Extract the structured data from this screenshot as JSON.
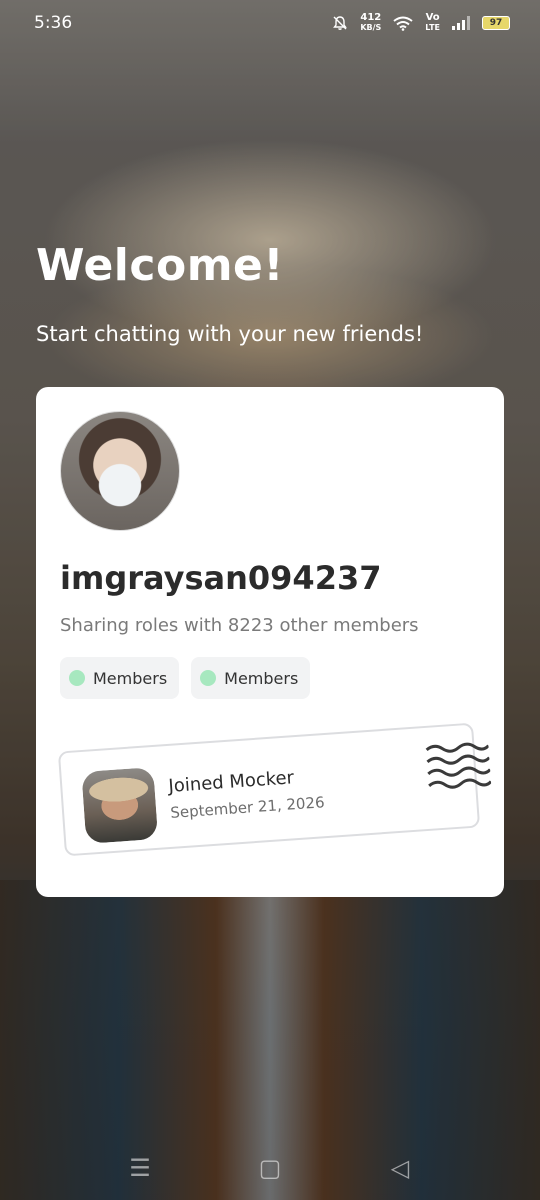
{
  "status_bar": {
    "time": "5:36",
    "net_speed_value": "412",
    "net_speed_unit": "KB/S",
    "network_label_top": "Vo",
    "network_label_bottom": "LTE",
    "battery": "97"
  },
  "welcome": {
    "title": "Welcome!",
    "subtitle": "Start chatting with your new friends!"
  },
  "profile": {
    "username": "imgraysan094237",
    "shared_roles_text": "Sharing roles with 8223 other members",
    "roles": [
      {
        "label": "Members",
        "color": "#a7e8bf"
      },
      {
        "label": "Members",
        "color": "#a7e8bf"
      }
    ],
    "joined": {
      "title": "Joined Mocker",
      "date": "September 21, 2026"
    }
  },
  "nav": {
    "menu_icon": "☰",
    "home_icon": "▢",
    "back_icon": "◁"
  }
}
